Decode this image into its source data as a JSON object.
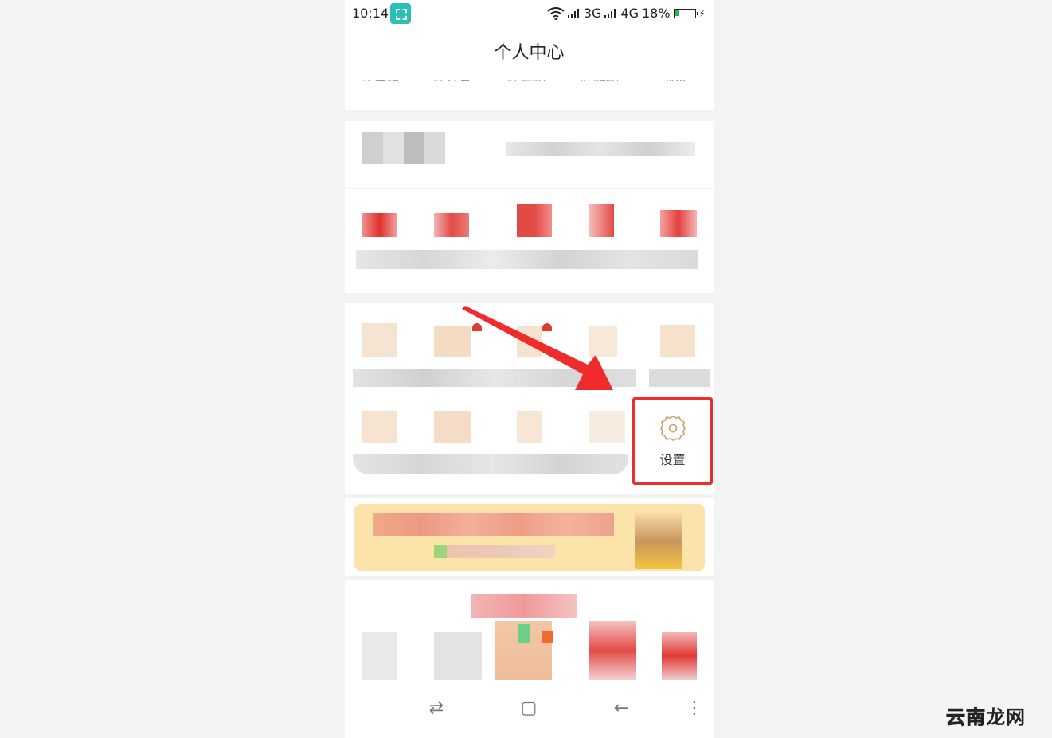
{
  "status_bar": {
    "time": "10:14",
    "net_3g": "3G",
    "net_4g": "4G",
    "battery": "18%",
    "wifi_icon": "wifi-icon",
    "battery_icon": "battery-icon"
  },
  "header": {
    "title": "个人中心"
  },
  "order_tabs": [
    "待付款",
    "待分享",
    "待发货",
    "待收货",
    "评价"
  ],
  "settings": {
    "label": "设置",
    "icon": "gear-icon",
    "highlight_color": "#ef2b2b"
  },
  "annotation": {
    "arrow_color": "#ef2b2b",
    "arrow_icon": "arrow-icon"
  },
  "nav": {
    "switch_icon": "switch-icon",
    "home_icon": "square-icon",
    "back_icon": "back-arrow-icon",
    "menu_icon": "menu-icon"
  },
  "watermark": {
    "part_a": "云南",
    "part_b": "龙网"
  }
}
